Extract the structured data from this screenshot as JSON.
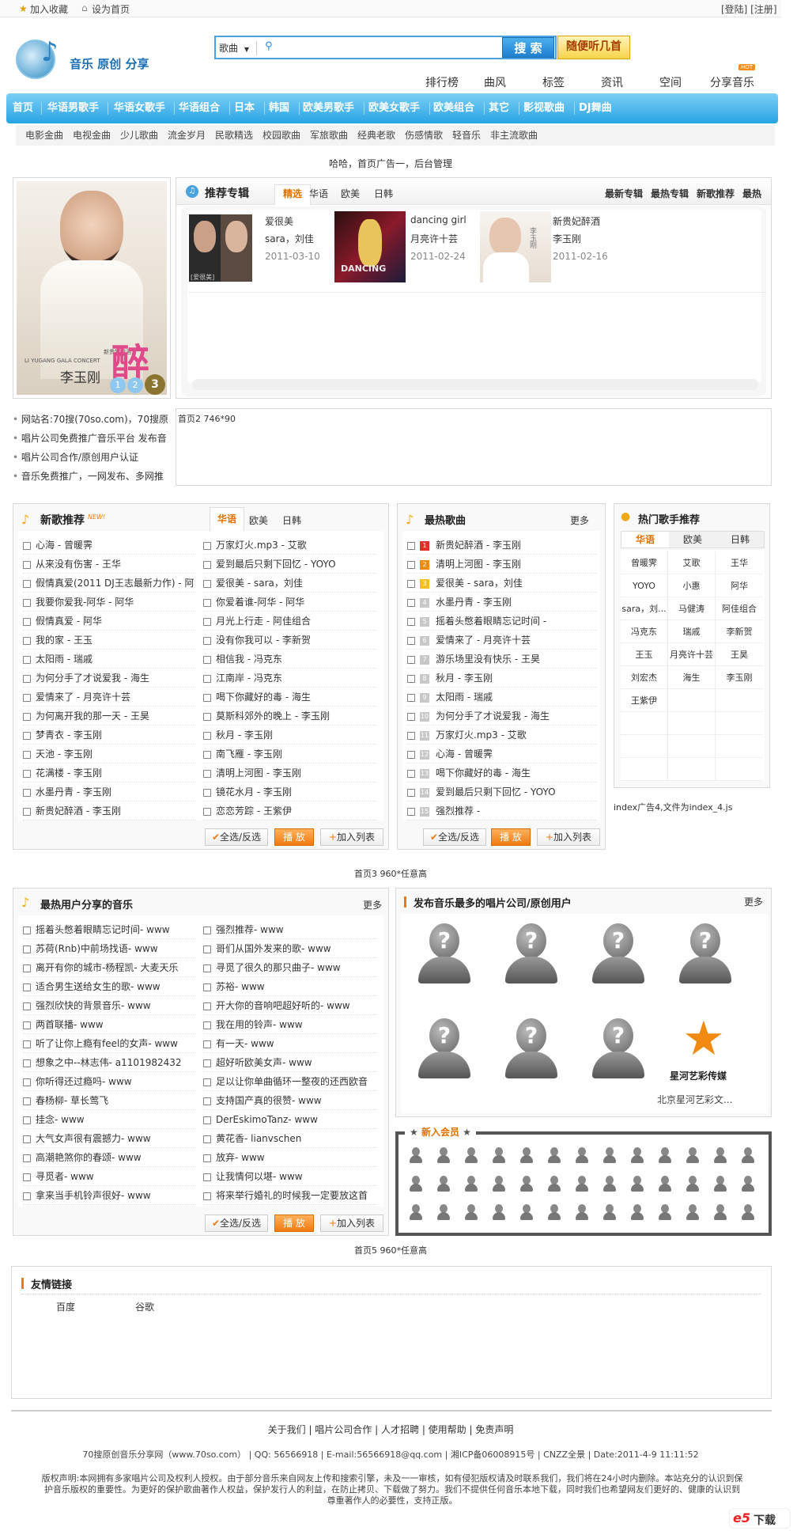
{
  "topbar": {
    "bookmark": "加入收藏",
    "homepage": "设为首页",
    "auth": "[登陆] [注册]"
  },
  "logo": {
    "text": "音乐 原创 分享"
  },
  "search": {
    "category": "歌曲",
    "button": "搜 索",
    "random_button": "随便听几首"
  },
  "nav2": [
    {
      "label": "排行榜"
    },
    {
      "label": "曲风"
    },
    {
      "label": "标签"
    },
    {
      "label": "资讯"
    },
    {
      "label": "空间"
    },
    {
      "label": "分享音乐"
    }
  ],
  "hot_badge": "HOT",
  "mainnav": [
    "首页",
    "华语男歌手",
    "华语女歌手",
    "华语组合",
    "日本",
    "韩国",
    "欧美男歌手",
    "欧美女歌手",
    "欧美组合",
    "其它",
    "影视歌曲",
    "DJ舞曲"
  ],
  "subnav": [
    "电影金曲",
    "电视金曲",
    "少儿歌曲",
    "流金岁月",
    "民歌精选",
    "校园歌曲",
    "军旅歌曲",
    "经典老歌",
    "伤感情歌",
    "轻音乐",
    "非主流歌曲"
  ],
  "ad1": "哈哈，首页广告一，后台管理",
  "banner": {
    "caption": "李玉刚",
    "concert": "LI YUGANG GALA CONCERT",
    "album_title": "新贵妃醉酒",
    "big_char": "醉",
    "dots": [
      "1",
      "2",
      "3"
    ]
  },
  "recommend": {
    "title": "推荐专辑",
    "tabs": [
      "精选",
      "华语",
      "欧美",
      "日韩"
    ],
    "links": [
      "最新专辑",
      "最热专辑",
      "新歌推荐",
      "最热"
    ],
    "albums": [
      {
        "title": "爱很美",
        "artist": "sara，刘佳",
        "date": "2011-03-10",
        "cover_label": "[爱很美]"
      },
      {
        "title": "dancing girl",
        "artist": "月亮许十芸",
        "date": "2011-02-24",
        "cover_label": "DANCING"
      },
      {
        "title": "新贵妃醉酒",
        "artist": "李玉刚",
        "date": "2011-02-16",
        "cover_label": "李玉刚"
      }
    ]
  },
  "info": [
    "网站名:70搜(70so.com)，70搜原",
    "唱片公司免费推广音乐平台 发布音",
    "唱片公司合作/原创用户认证",
    "音乐免费推广，一网发布、多网推"
  ],
  "ad2": "首页2 746*90",
  "newsongs": {
    "title": "新歌推荐",
    "new_badge": "NEW!",
    "tabs": [
      "华语",
      "欧美",
      "日韩"
    ],
    "left": [
      "心海 - 曾暖霁",
      "从来没有伤害 - 王华",
      "假情真爱(2011 DJ王志最新力作) - 阿",
      "我要你爱我-阿华 - 阿华",
      "假情真爱 - 阿华",
      "我的家 - 王玉",
      "太阳雨 - 瑞戚",
      "为何分手了才说爱我 - 海生",
      "爱情来了 - 月亮许十芸",
      "为何离开我的那一天 - 王昊",
      "梦青衣 - 李玉刚",
      "天池 - 李玉刚",
      "花满楼 - 李玉刚",
      "水墨丹青 - 李玉刚",
      "新贵妃醉酒 - 李玉刚"
    ],
    "right": [
      "万家灯火.mp3 - 艾歌",
      "爱到最后只剩下回忆 - YOYO",
      "爱很美 - sara，刘佳",
      "你爱着谁-阿华 - 阿华",
      "月光上行走 - 阿佳组合",
      "没有你我可以 - 李新贺",
      "相信我 - 冯克东",
      "江南岸 - 冯克东",
      "喝下你藏好的毒 - 海生",
      "莫斯科郊外的晚上 - 李玉刚",
      "秋月 - 李玉刚",
      "南飞雁 - 李玉刚",
      "清明上河图 - 李玉刚",
      "镜花水月 - 李玉刚",
      "恋恋芳踪 - 王紫伊"
    ],
    "btn_select": "全选/反选",
    "btn_play": "播 放",
    "btn_add": "加入列表"
  },
  "hotsongs": {
    "title": "最热歌曲",
    "more": "更多",
    "items": [
      "新贵妃醉酒 - 李玉刚",
      "清明上河图 - 李玉刚",
      "爱很美 - sara，刘佳",
      "水墨丹青 - 李玉刚",
      "摇着头憋着眼睛忘记时间 -",
      "爱情来了 - 月亮许十芸",
      "游乐场里没有快乐 - 王昊",
      "秋月 - 李玉刚",
      "太阳雨 - 瑞戚",
      "为何分手了才说爱我 - 海生",
      "万家灯火.mp3 - 艾歌",
      "心海 - 曾暖霁",
      "喝下你藏好的毒 - 海生",
      "爱到最后只剩下回忆 - YOYO",
      "强烈推荐 -"
    ],
    "ranks": [
      "1",
      "2",
      "3",
      "4",
      "5",
      "6",
      "7",
      "8",
      "9",
      "10",
      "11",
      "12",
      "13",
      "14",
      "15"
    ],
    "btn_select": "全选/反选",
    "btn_play": "播 放",
    "btn_add": "加入列表"
  },
  "singers": {
    "title": "热门歌手推荐",
    "tabs": [
      "华语",
      "欧美",
      "日韩"
    ],
    "names": [
      "曾暖霁",
      "艾歌",
      "王华",
      "YOYO",
      "小惠",
      "阿华",
      "sara，刘...",
      "马健涛",
      "阿佳组合",
      "冯克东",
      "瑞戚",
      "李新贺",
      "王玉",
      "月亮许十芸",
      "王昊",
      "刘宏杰",
      "海生",
      "李玉刚",
      "王紫伊",
      "",
      "",
      "",
      "",
      "",
      "",
      "",
      "",
      "",
      "",
      ""
    ]
  },
  "ad4": "index广告4,文件为index_4.js",
  "ad3": "首页3 960*任意高",
  "usershare": {
    "title": "最热用户分享的音乐",
    "more": "更多",
    "left": [
      "摇着头憋着眼睛忘记时间- www",
      "苏荷(Rnb)中前场找语- www",
      "离开有你的城市-杨程凯- 大麦天乐",
      "适合男生送给女生的歌- www",
      "强烈欣快的背景音乐- www",
      "两首联播- www",
      "听了让你上瘾有feel的女声- www",
      "想象之中--林志伟- a1101982432",
      "你听得还过瘾吗- www",
      "春杨柳- 草长莺飞",
      "挂念- www",
      "大气女声很有震撼力- www",
      "高潮艳煞你的春颂- www",
      "寻觅者- www",
      "拿来当手机铃声很好- www"
    ],
    "right": [
      "强烈推荐- www",
      "哥们从国外发来的歌- www",
      "寻觅了很久的那只曲子- www",
      "苏裕- www",
      "开大你的音响吧超好听的- www",
      "我在用的铃声- www",
      "有一天- www",
      "超好听欧美女声- www",
      "足以让你单曲循环一整夜的还西欧音",
      "支持国产真的很赞- www",
      "DerEskimoTanz- www",
      "黄花香- lianvschen",
      "放弃- www",
      "让我情何以堪- www",
      "将来举行婚礼的时候我一定要放这首"
    ],
    "btn_select": "全选/反选",
    "btn_play": "播 放",
    "btn_add": "加入列表"
  },
  "labels": {
    "title": "发布音乐最多的唱片公司/原创用户",
    "more": "更多",
    "star_name": "星河艺彩传媒",
    "star_caption": "北京星河艺彩文..."
  },
  "members": {
    "title": "新入会员"
  },
  "ad5": "首页5 960*任意高",
  "friends": {
    "title": "友情链接",
    "links": [
      "百度",
      "谷歌"
    ]
  },
  "footer": {
    "links": [
      "关于我们",
      "唱片公司合作",
      "人才招聘",
      "使用帮助",
      "免责声明"
    ],
    "line2": "70搜原创音乐分享网（www.70so.com） | QQ: 56566918 | E-mail:56566918@qq.com | 湘ICP备06008915号 | CNZZ全景 | Date:2011-4-9 11:11:52",
    "line3": "版权声明:本网拥有多家唱片公司及权利人授权。由于部分音乐来自网友上传和搜索引擎，未及一一审核，如有侵犯版权请及时联系我们，我们将在24小时内删除。本站充分的认识到保",
    "line4": "护音乐版权的重要性。为更好的保护歌曲著作人权益，保护发行人的利益，在防止拷贝、下载做了努力。我们不提供任何音乐本地下载，同时我们也希望网友们更好的、健康的认识到",
    "line5": "尊重著作人的必要性，支持正版。"
  },
  "watermark": "下载",
  "colors": {
    "accent": "#28a4e4",
    "orange": "#f07a10",
    "tab_active": "#e07000"
  }
}
